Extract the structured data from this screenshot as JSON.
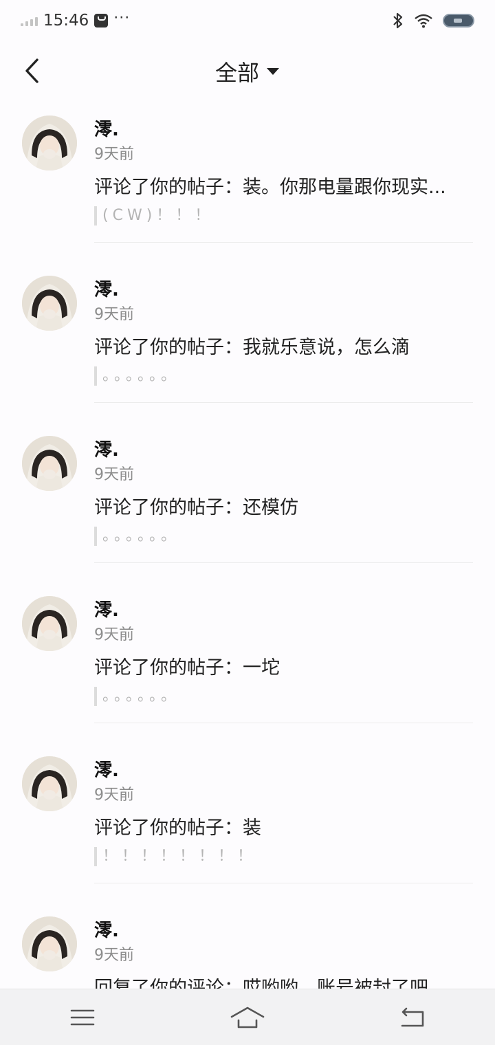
{
  "status_bar": {
    "time": "15:46",
    "more_dots": "···",
    "icons": [
      "signal-icon",
      "message-icon",
      "bluetooth-icon",
      "wifi-icon",
      "battery-icon"
    ]
  },
  "header": {
    "title": "全部",
    "back_icon": "chevron-left-icon",
    "dropdown_icon": "caret-down-icon"
  },
  "notifications": [
    {
      "username": "澪.",
      "time": "9天前",
      "comment": "评论了你的帖子：装。你那电量跟你现实...",
      "quote": "(CW)！！！"
    },
    {
      "username": "澪.",
      "time": "9天前",
      "comment": "评论了你的帖子：我就乐意说，怎么滴",
      "quote": "。。。。。。"
    },
    {
      "username": "澪.",
      "time": "9天前",
      "comment": "评论了你的帖子：还模仿",
      "quote": "。。。。。。"
    },
    {
      "username": "澪.",
      "time": "9天前",
      "comment": "评论了你的帖子：一坨",
      "quote": "。。。。。。"
    },
    {
      "username": "澪.",
      "time": "9天前",
      "comment": "评论了你的帖子：装",
      "quote": "！！！！！！！！"
    },
    {
      "username": "澪.",
      "time": "9天前",
      "comment": "回复了你的评论：哎哟哟，账号被封了吧",
      "quote": ""
    }
  ],
  "bottom_nav": {
    "icons": [
      "menu-icon",
      "home-icon",
      "back-icon"
    ]
  },
  "colors": {
    "background": "#fdfcfe",
    "text": "#222222",
    "muted": "#8c8c8c",
    "quote_text": "#b4b4b4",
    "nav_bar": "#f2f2f3"
  }
}
